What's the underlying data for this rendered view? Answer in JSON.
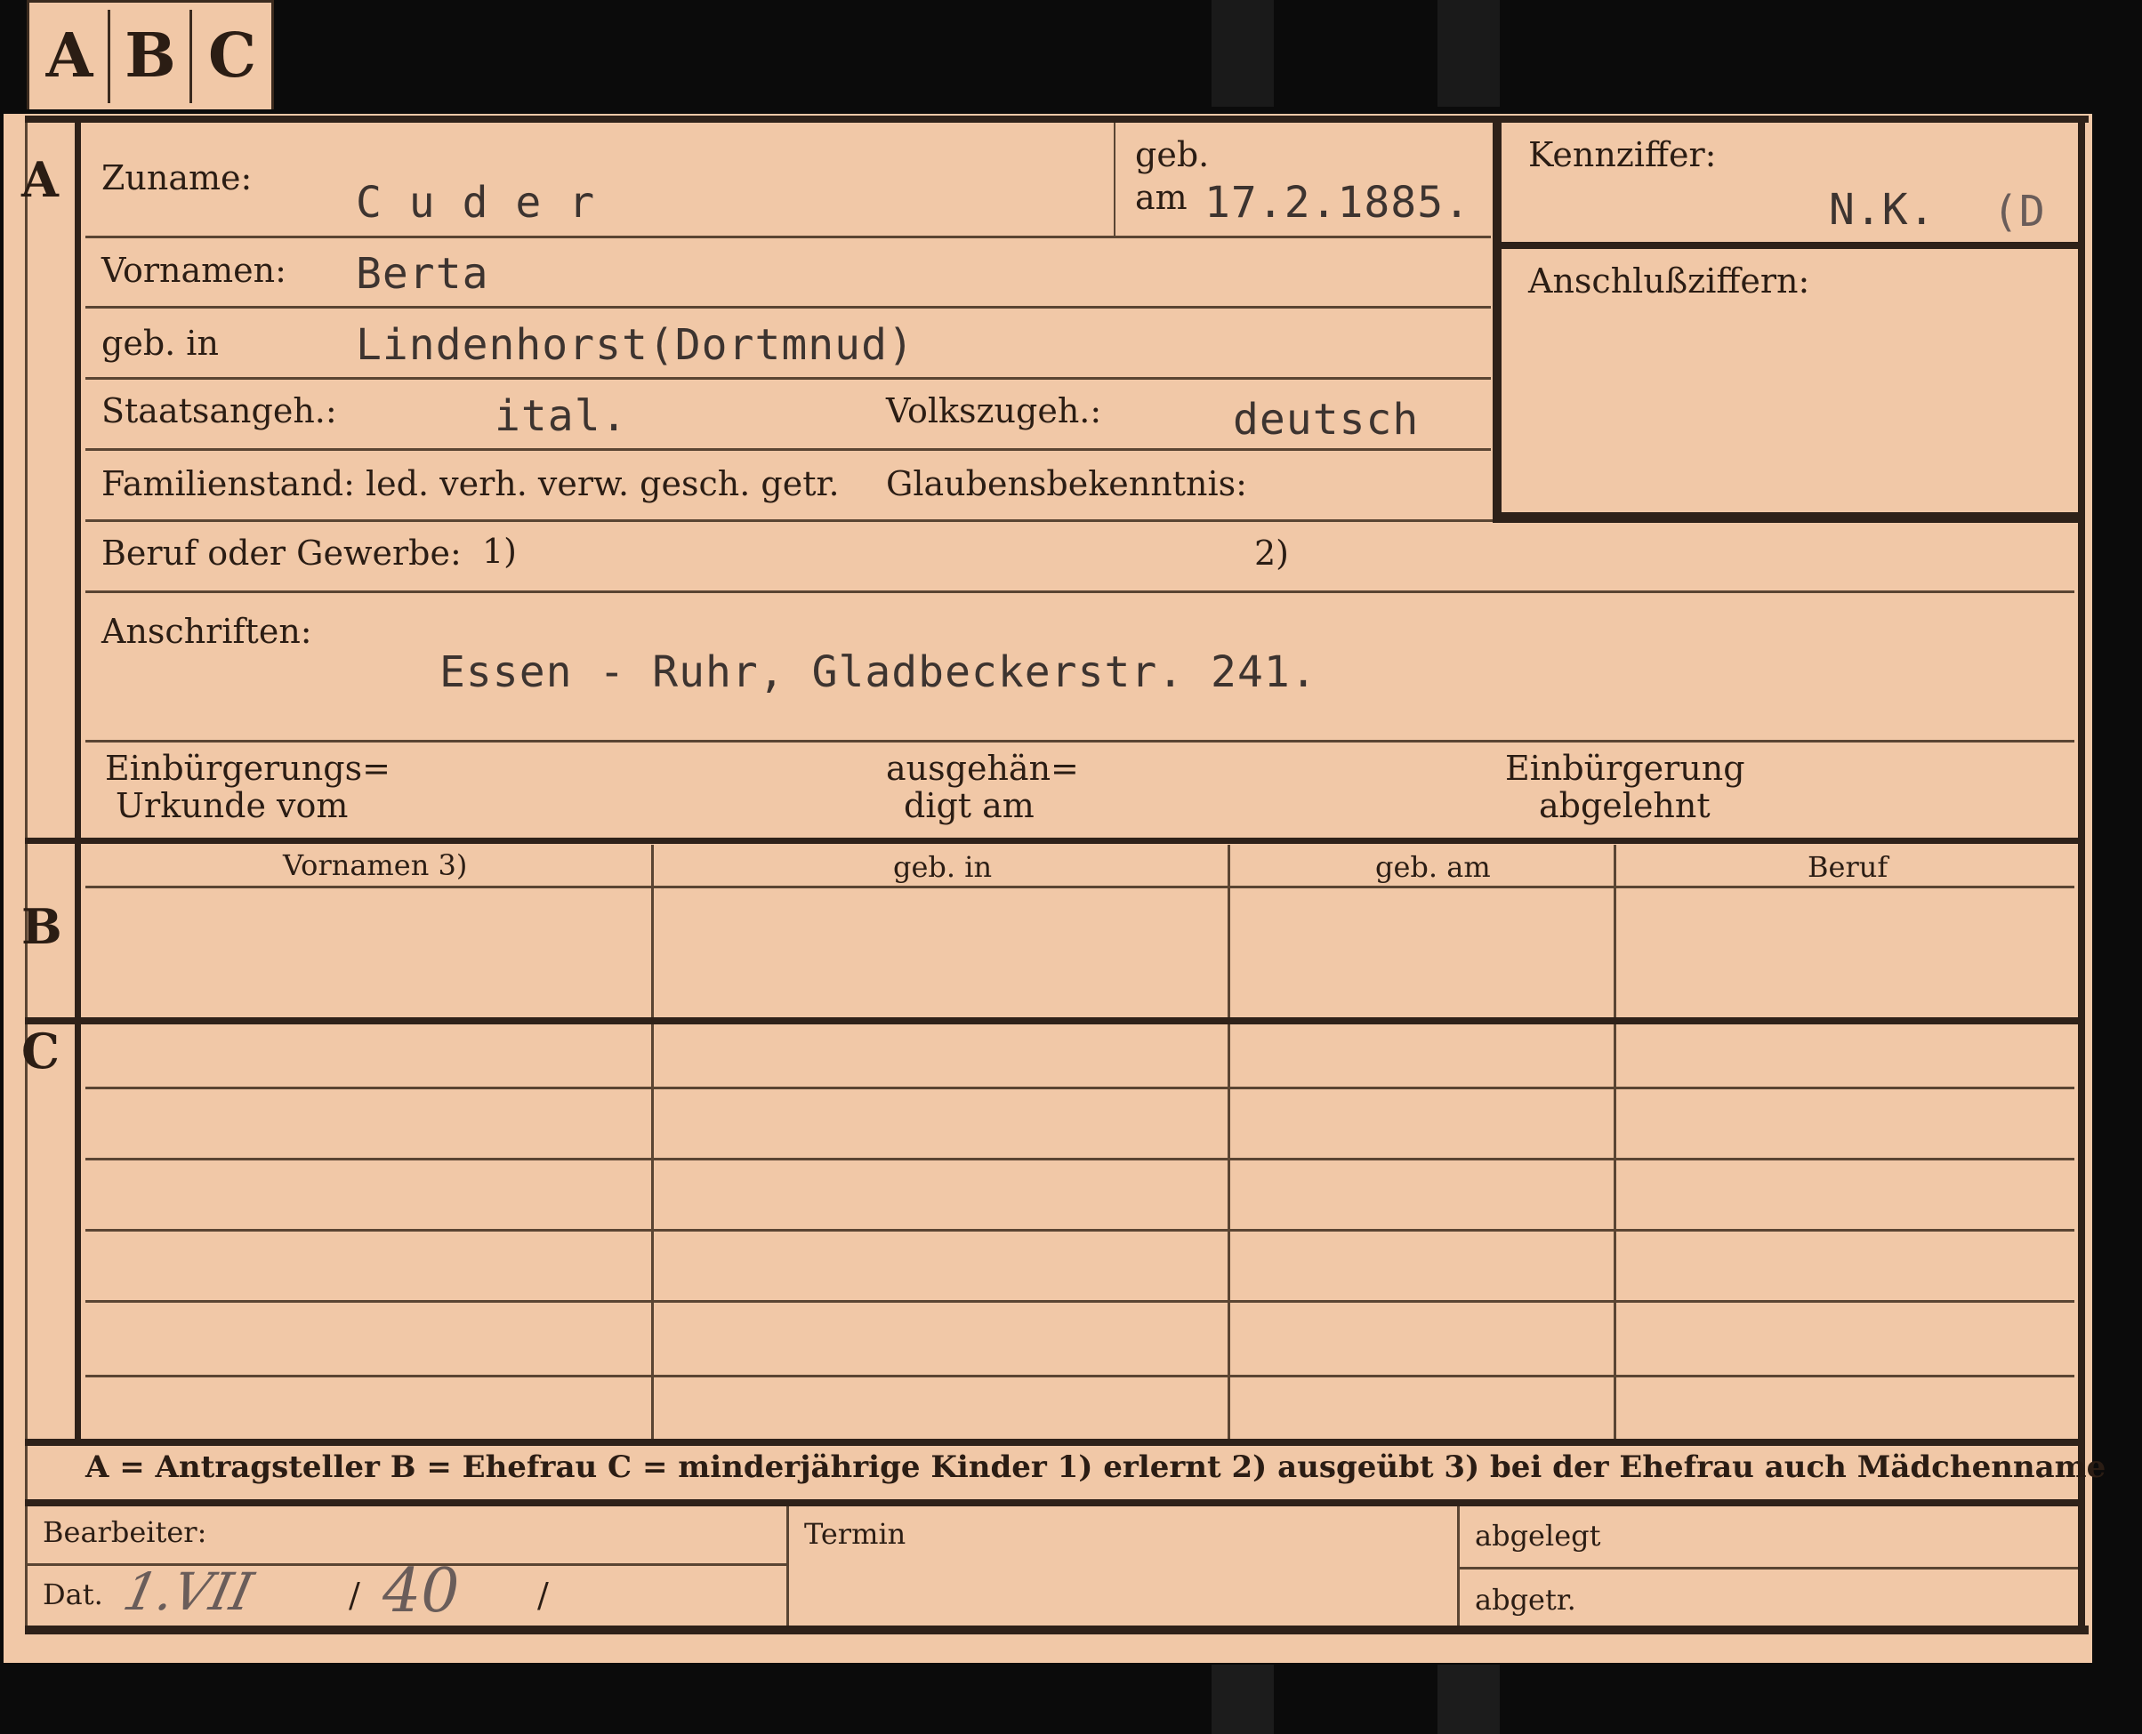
{
  "tabs": [
    "A",
    "B",
    "C"
  ],
  "section_a": {
    "marker": "A",
    "zuname_label": "Zuname:",
    "zuname_value": "C u d e r",
    "geb_label": "geb.",
    "am_label": "am",
    "geb_am_value": "17.2.1885.",
    "vornamen_label": "Vornamen:",
    "vornamen_value": "Berta",
    "geb_in_label": "geb. in",
    "geb_in_value": "Lindenhorst(Dortmnud)",
    "staatsangeh_label": "Staatsangeh.:",
    "staatsangeh_value": "ital.",
    "volkszugeh_label": "Volkszugeh.:",
    "volkszugeh_value": "deutsch",
    "familienstand_label": "Familienstand: led. verh. verw. gesch. getr.",
    "glaubens_label": "Glaubensbekenntnis:",
    "beruf_label": "Beruf oder Gewerbe:",
    "beruf_note1": "1)",
    "beruf_note2": "2)",
    "anschriften_label": "Anschriften:",
    "anschriften_value": "Essen - Ruhr, Gladbeckerstr. 241.",
    "einb_urkunde_line1": "Einbürgerungs=",
    "einb_urkunde_line2": "Urkunde vom",
    "ausgehaendigt_line1": "ausgehän=",
    "ausgehaendigt_line2": "digt am",
    "einb_abgelehnt_line1": "Einbürgerung",
    "einb_abgelehnt_line2": "abgelehnt",
    "kennziffer_label": "Kennziffer:",
    "kennziffer_value": "N.K.",
    "kennziffer_mark": "(D",
    "anschluss_label": "Anschlußziffern:"
  },
  "section_b": {
    "marker": "B",
    "columns": [
      "Vornamen 3)",
      "geb. in",
      "geb. am",
      "Beruf"
    ]
  },
  "section_c": {
    "marker": "C"
  },
  "legend": "A = Antragsteller   B = Ehefrau   C = minderjährige Kinder   1) erlernt   2) ausgeübt   3) bei der Ehefrau auch Mädchenname",
  "footer": {
    "bearbeiter_label": "Bearbeiter:",
    "dat_label": "Dat.",
    "dat_handwritten_day": "1.VII",
    "dat_sep1": "/",
    "dat_handwritten_year": "40",
    "dat_sep2": "/",
    "termin_label": "Termin",
    "abgelegt_label": "abgelegt",
    "abgetr_label": "abgetr."
  }
}
